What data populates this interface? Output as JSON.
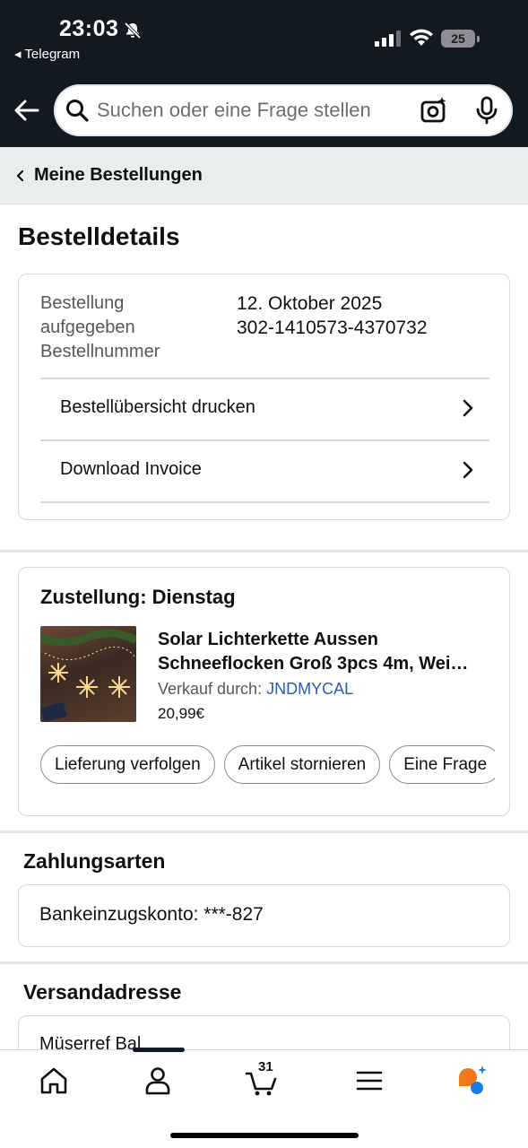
{
  "status_bar": {
    "time": "23:03",
    "back_app": "◂ Telegram",
    "battery": "25"
  },
  "search": {
    "placeholder": "Suchen oder eine Frage stellen"
  },
  "breadcrumb": {
    "label": "Meine Bestellungen"
  },
  "page_title": "Bestelldetails",
  "order_info": {
    "placed_label_line1": "Bestellung",
    "placed_label_line2": "aufgegeben",
    "number_label": "Bestellnummer",
    "date": "12. Oktober 2025",
    "number": "302-1410573-4370732",
    "links": [
      "Bestellübersicht drucken",
      "Download Invoice"
    ]
  },
  "delivery": {
    "title": "Zustellung: Dienstag",
    "product_title_line1": "Solar Lichterkette Aussen",
    "product_title_line2": "Schneeflocken Groß 3pcs 4m, Wei…",
    "sold_by_label": "Verkauf durch: ",
    "seller": "JNDMYCAL",
    "price": "20,99€",
    "actions": [
      "Lieferung verfolgen",
      "Artikel stornieren",
      "Eine Frage"
    ]
  },
  "payment": {
    "title": "Zahlungsarten",
    "method": "Bankeinzugskonto: ***-827"
  },
  "shipping": {
    "title": "Versandadresse",
    "name": "Müserref Bal"
  },
  "bottom_nav": {
    "cart_count": "31"
  },
  "colors": {
    "header_bg": "#131921",
    "link": "#2a5bb8",
    "crumb_bg": "#eaeded"
  }
}
